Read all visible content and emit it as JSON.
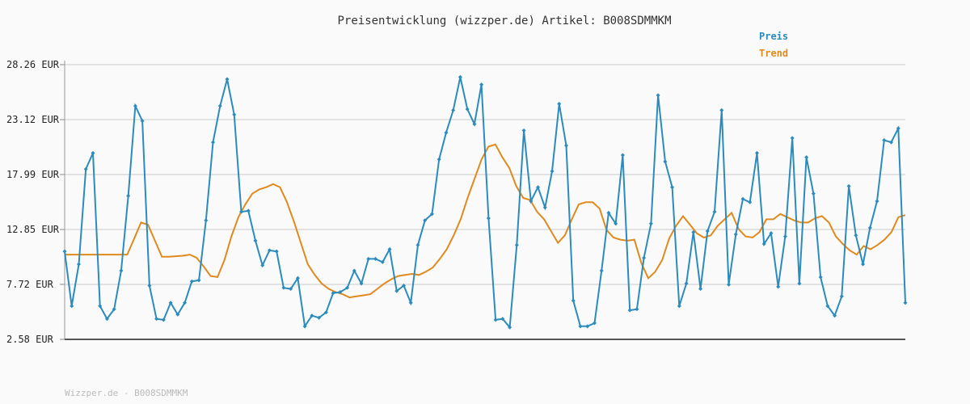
{
  "title": "Preisentwicklung (wizzper.de) Artikel: B008SDMMKM",
  "footer": "Wizzper.de - B008SDMMKM",
  "colors": {
    "preis": "#2b8bbd",
    "trend": "#e08a1e",
    "grid": "#e2e2e2"
  },
  "chart_data": {
    "type": "line",
    "title": "Preisentwicklung (wizzper.de) Artikel: B008SDMMKM",
    "xlabel": "",
    "ylabel": "",
    "ylim": [
      2.58,
      28.26
    ],
    "yticks": [
      "28.26 EUR",
      "23.12 EUR",
      "17.99 EUR",
      "12.85 EUR",
      "7.72 EUR",
      "2.58 EUR"
    ],
    "ytick_values": [
      28.26,
      23.12,
      17.99,
      12.85,
      7.72,
      2.58
    ],
    "grid": true,
    "legend": "top-right",
    "series": [
      {
        "name": "Preis",
        "values": [
          10.8,
          5.7,
          9.6,
          18.5,
          20.0,
          5.7,
          4.5,
          5.4,
          9.0,
          16.0,
          24.4,
          23.0,
          7.6,
          4.5,
          4.4,
          6.0,
          4.9,
          6.0,
          8.0,
          8.1,
          13.7,
          21.0,
          24.4,
          26.9,
          23.6,
          14.5,
          14.6,
          11.8,
          9.5,
          10.9,
          10.8,
          7.4,
          7.3,
          8.3,
          3.8,
          4.8,
          4.6,
          5.1,
          6.9,
          7.0,
          7.4,
          9.0,
          7.8,
          10.1,
          10.1,
          9.8,
          11.0,
          7.1,
          7.6,
          6.0,
          11.4,
          13.7,
          14.3,
          19.4,
          21.9,
          24.0,
          27.1,
          24.1,
          22.7,
          26.4,
          13.9,
          4.4,
          4.5,
          3.7,
          11.4,
          22.1,
          15.5,
          16.8,
          14.9,
          18.3,
          24.6,
          20.7,
          6.2,
          3.8,
          3.8,
          4.1,
          9.0,
          14.4,
          13.4,
          19.8,
          5.3,
          5.4,
          10.2,
          13.4,
          25.4,
          19.2,
          16.8,
          5.7,
          7.8,
          12.6,
          7.3,
          12.7,
          14.5,
          24.0,
          7.7,
          12.4,
          15.7,
          15.4,
          20.0,
          11.5,
          12.5,
          7.5,
          12.2,
          21.4,
          7.8,
          19.6,
          16.2,
          8.4,
          5.7,
          4.8,
          6.6,
          16.9,
          12.3,
          9.6,
          13.0,
          15.5,
          21.2,
          21.0,
          22.3,
          6.0
        ]
      },
      {
        "name": "Trend",
        "values": [
          10.5,
          10.5,
          10.5,
          10.5,
          10.5,
          10.5,
          10.5,
          10.5,
          10.5,
          10.5,
          12.0,
          13.5,
          13.3,
          11.8,
          10.3,
          10.3,
          10.35,
          10.4,
          10.5,
          10.2,
          9.4,
          8.5,
          8.4,
          10.0,
          12.2,
          14.0,
          15.2,
          16.2,
          16.6,
          16.8,
          17.1,
          16.8,
          15.4,
          13.6,
          11.6,
          9.6,
          8.6,
          7.8,
          7.3,
          7.0,
          6.8,
          6.5,
          6.6,
          6.7,
          6.8,
          7.3,
          7.8,
          8.2,
          8.5,
          8.6,
          8.7,
          8.6,
          8.9,
          9.3,
          10.1,
          11.0,
          12.3,
          13.8,
          15.8,
          17.6,
          19.4,
          20.6,
          20.8,
          19.6,
          18.6,
          16.9,
          15.8,
          15.6,
          14.5,
          13.8,
          12.7,
          11.6,
          12.3,
          13.8,
          15.2,
          15.4,
          15.4,
          14.8,
          12.8,
          12.1,
          11.9,
          11.8,
          11.9,
          9.7,
          8.3,
          8.9,
          10.0,
          12.0,
          13.2,
          14.1,
          13.3,
          12.5,
          12.1,
          12.3,
          13.2,
          13.8,
          14.4,
          12.9,
          12.2,
          12.1,
          12.6,
          13.8,
          13.8,
          14.3,
          14.0,
          13.7,
          13.5,
          13.5,
          13.9,
          14.1,
          13.5,
          12.2,
          11.5,
          10.9,
          10.5,
          11.3,
          11.0,
          11.4,
          11.9,
          12.6,
          14.0,
          14.2
        ]
      }
    ]
  }
}
